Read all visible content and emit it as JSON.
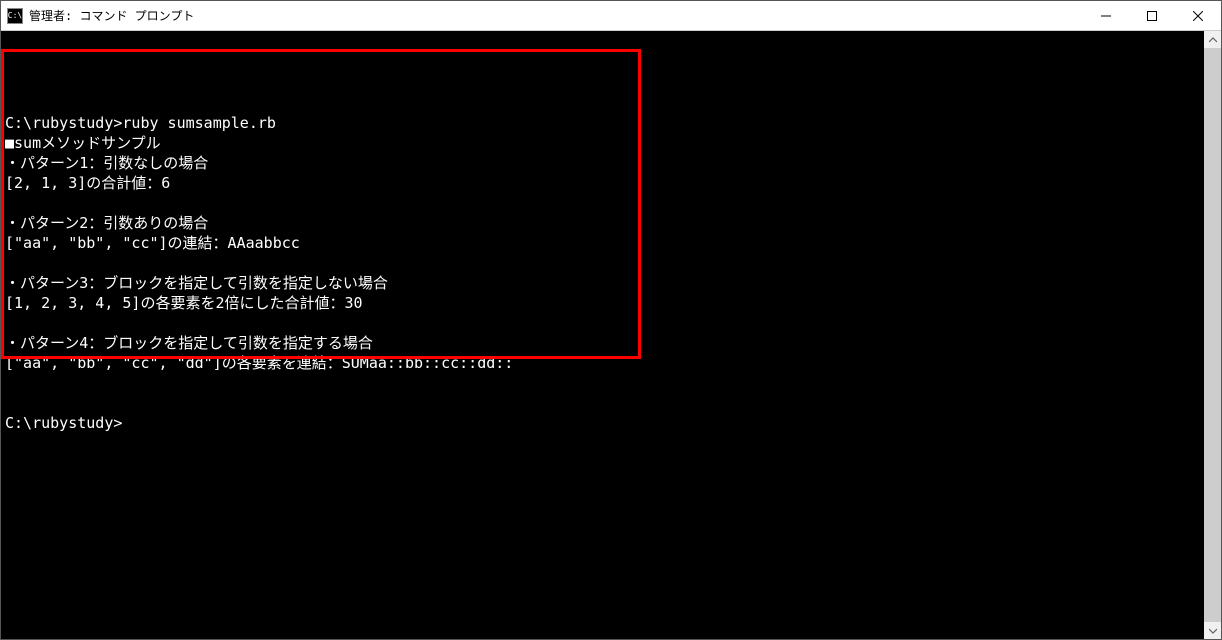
{
  "window": {
    "title": "管理者: コマンド プロンプト",
    "icon_label": "C:\\"
  },
  "terminal": {
    "lines": [
      "",
      "C:\\rubystudy>ruby sumsample.rb",
      "■sumメソッドサンプル",
      "・パターン1：引数なしの場合",
      "[2, 1, 3]の合計値：6",
      "",
      "・パターン2：引数ありの場合",
      "[\"aa\", \"bb\", \"cc\"]の連結：AAaabbcc",
      "",
      "・パターン3：ブロックを指定して引数を指定しない場合",
      "[1, 2, 3, 4, 5]の各要素を2倍にした合計値：30",
      "",
      "・パターン4：ブロックを指定して引数を指定する場合",
      "[\"aa\", \"bb\", \"cc\", \"dd\"]の各要素を連結：SUMaa::bb::cc::dd::",
      "",
      "",
      "C:\\rubystudy>"
    ]
  }
}
